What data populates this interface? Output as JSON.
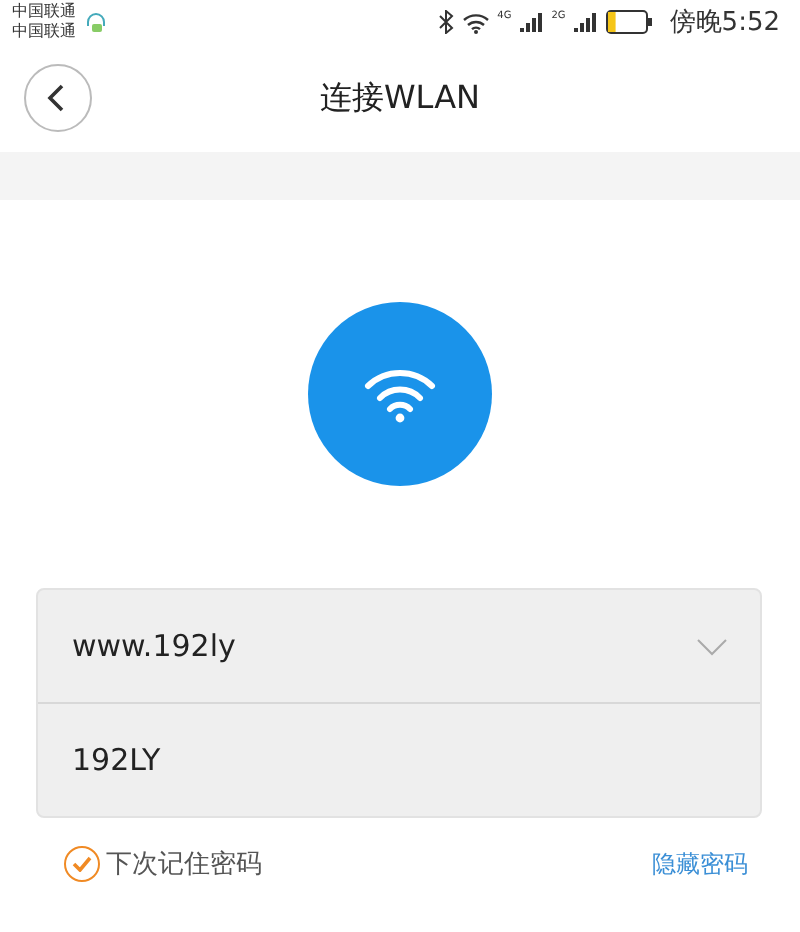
{
  "status_bar": {
    "carriers": [
      "中国联通",
      "中国联通"
    ],
    "network_labels": [
      "4G",
      "2G"
    ],
    "battery": {
      "level": 0.2
    },
    "time": "傍晚5:52"
  },
  "header": {
    "title": "连接WLAN"
  },
  "form": {
    "network_name": {
      "value": "www.192ly",
      "expanded": false
    },
    "password": {
      "value": "192LY"
    }
  },
  "remember": {
    "label": "下次记住密码",
    "checked": true
  },
  "toggle_link": "隐藏密码"
}
